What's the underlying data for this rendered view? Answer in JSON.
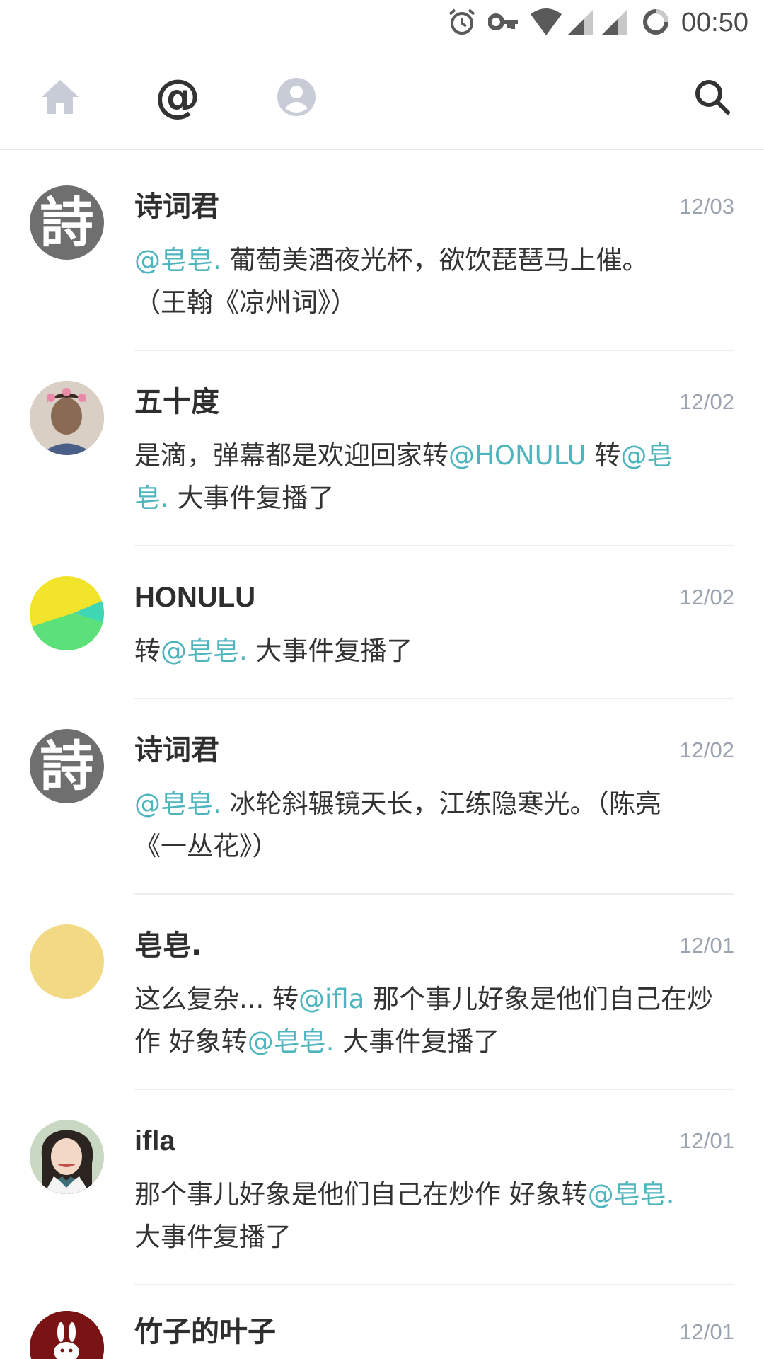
{
  "status_bar": {
    "time": "00:50",
    "icons": [
      "alarm-icon",
      "vpn-key-icon",
      "wifi-icon",
      "signal-icon",
      "signal-icon-2",
      "loading-ring-icon"
    ]
  },
  "nav": {
    "tabs": [
      "home-icon",
      "mention-icon",
      "profile-icon"
    ],
    "active_tab": "mention-icon",
    "search_icon": "search-icon",
    "at_symbol": "@"
  },
  "colors": {
    "mention": "#4eb4be",
    "date": "#9aa3b0",
    "author": "#2e2e2e"
  },
  "feed": [
    {
      "author": "诗词君",
      "date": "12/03",
      "avatar_char": "詩",
      "segments": [
        {
          "t": "@皂皂.",
          "m": true
        },
        {
          "t": " 葡萄美酒夜光杯，欲饮琵琶马上催。（王翰《凉州词》）",
          "m": false
        }
      ]
    },
    {
      "author": "五十度",
      "date": "12/02",
      "segments": [
        {
          "t": "是滴，弹幕都是欢迎回家转",
          "m": false
        },
        {
          "t": "@HONULU",
          "m": true
        },
        {
          "t": " 转",
          "m": false
        },
        {
          "t": "@皂皂.",
          "m": true
        },
        {
          "t": " 大事件复播了",
          "m": false
        }
      ]
    },
    {
      "author": "HONULU",
      "date": "12/02",
      "segments": [
        {
          "t": "转",
          "m": false
        },
        {
          "t": "@皂皂.",
          "m": true
        },
        {
          "t": " 大事件复播了",
          "m": false
        }
      ]
    },
    {
      "author": "诗词君",
      "date": "12/02",
      "avatar_char": "詩",
      "segments": [
        {
          "t": "@皂皂.",
          "m": true
        },
        {
          "t": " 冰轮斜辗镜天长，江练隐寒光。（陈亮《一丛花》）",
          "m": false
        }
      ]
    },
    {
      "author": "皂皂.",
      "date": "12/01",
      "segments": [
        {
          "t": "这么复杂... 转",
          "m": false
        },
        {
          "t": "@ifla",
          "m": true
        },
        {
          "t": " 那个事儿好象是他们自己在炒作 好象转",
          "m": false
        },
        {
          "t": "@皂皂.",
          "m": true
        },
        {
          "t": " 大事件复播了",
          "m": false
        }
      ]
    },
    {
      "author": "ifla",
      "date": "12/01",
      "segments": [
        {
          "t": "那个事儿好象是他们自己在炒作 好象转",
          "m": false
        },
        {
          "t": "@皂皂.",
          "m": true
        },
        {
          "t": " 大事件复播了",
          "m": false
        }
      ]
    },
    {
      "author": "竹子的叶子",
      "date": "12/01",
      "segments": []
    }
  ]
}
